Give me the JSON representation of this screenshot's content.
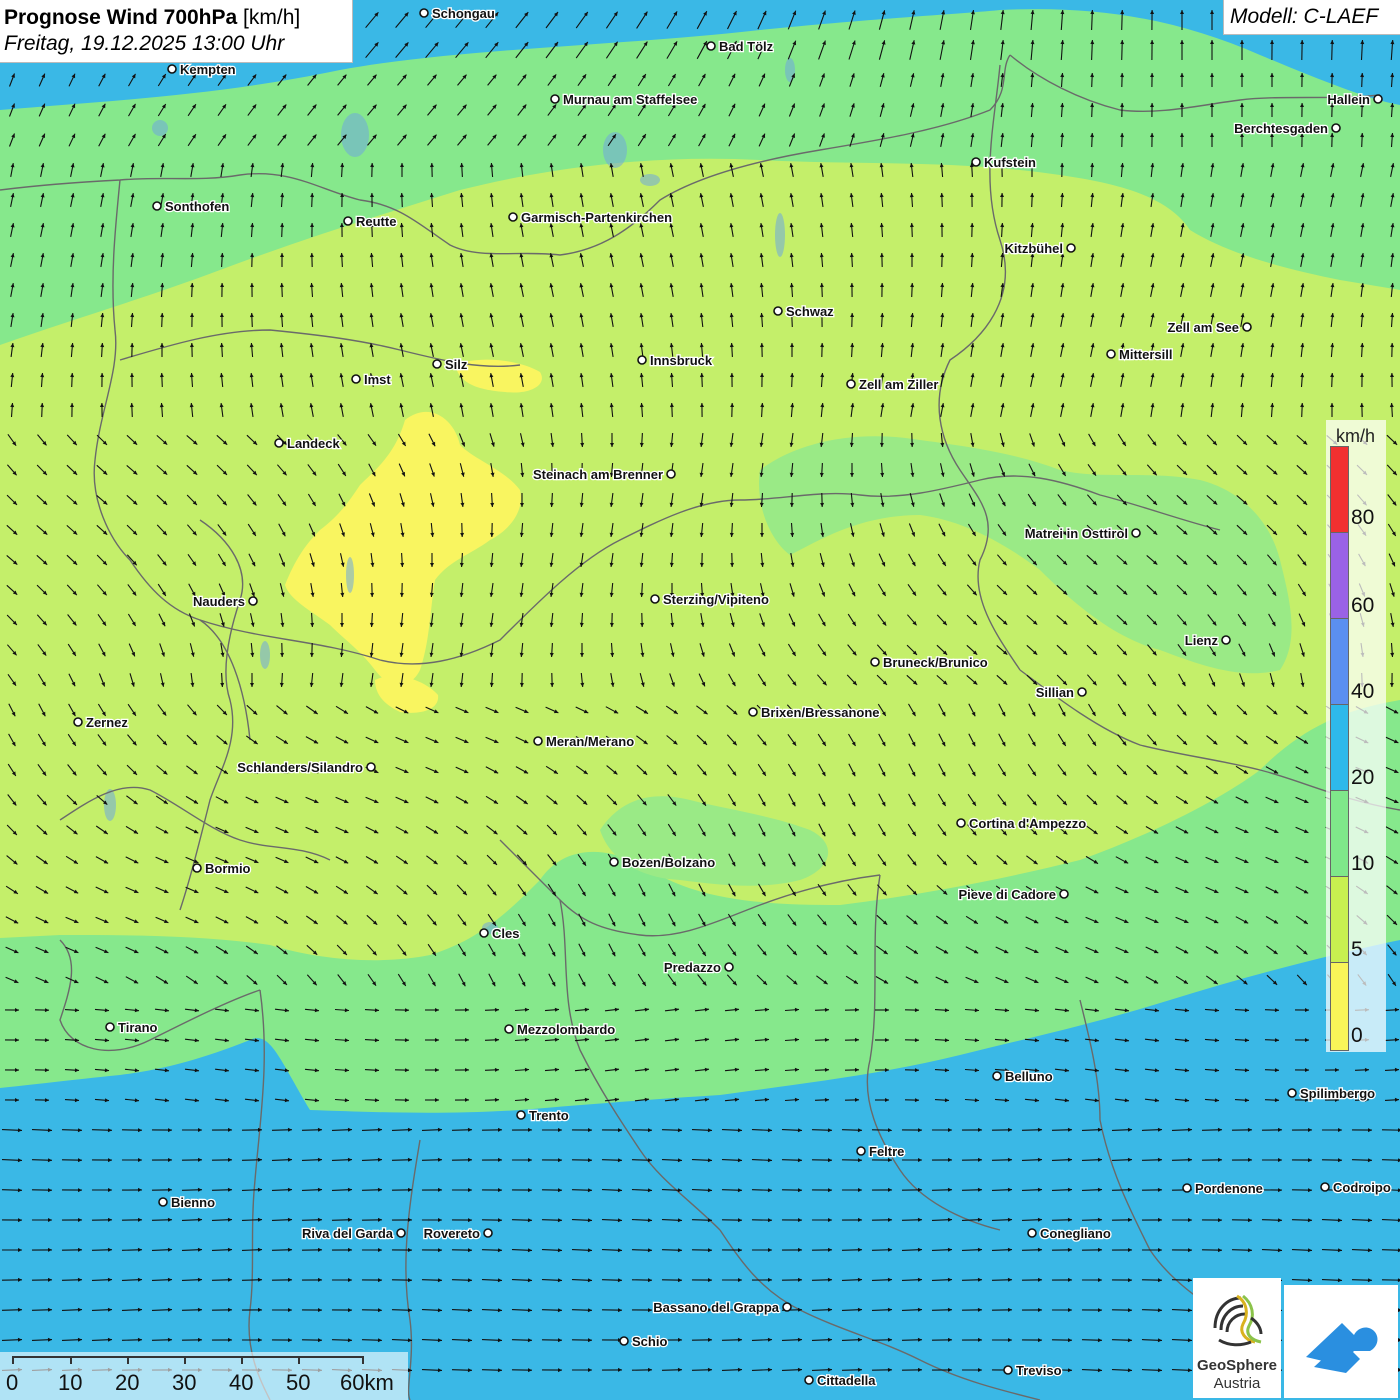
{
  "header": {
    "title": "Prognose Wind 700hPa",
    "unit": " [km/h]",
    "date": "Freitag, 19.12.2025 13:00 Uhr"
  },
  "model": {
    "label": "Modell: C-LAEF"
  },
  "legend": {
    "unit": "km/h",
    "labels": [
      "80",
      "60",
      "40",
      "20",
      "10",
      "5",
      "0"
    ],
    "colors": {
      "80": "#f23030",
      "60": "#9a62e6",
      "40": "#5b8ff0",
      "20": "#2eb9ea",
      "10": "#7fe88a",
      "5": "#c8f050",
      "0": "#f9f558"
    }
  },
  "scale": {
    "labels": [
      "0",
      "10",
      "20",
      "30",
      "40",
      "50",
      "60km"
    ]
  },
  "logos": {
    "geosphere_line1": "GeoSphere",
    "geosphere_line2": "Austria"
  },
  "palette": {
    "zone_blue": "#3ab8e6",
    "zone_green": "#86e88c",
    "zone_lime": "#c4ef6a",
    "zone_yellow": "#f9f560",
    "border_color": "#6a6a6a",
    "arrow_color": "#111111"
  },
  "cities": [
    {
      "name": "Schongau",
      "label_side": "right"
    },
    {
      "name": "Bad Tölz",
      "label_side": "right"
    },
    {
      "name": "Kempten",
      "label_side": "right"
    },
    {
      "name": "Murnau am Staffelsee",
      "label_side": "right"
    },
    {
      "name": "Hallein",
      "label_side": "left"
    },
    {
      "name": "Berchtesgaden",
      "label_side": "left"
    },
    {
      "name": "Kufstein",
      "label_side": "right"
    },
    {
      "name": "Sonthofen",
      "label_side": "right"
    },
    {
      "name": "Reutte",
      "label_side": "right"
    },
    {
      "name": "Garmisch-Partenkirchen",
      "label_side": "right"
    },
    {
      "name": "Kitzbühel",
      "label_side": "left"
    },
    {
      "name": "Schwaz",
      "label_side": "right"
    },
    {
      "name": "Zell am See",
      "label_side": "left"
    },
    {
      "name": "Silz",
      "label_side": "right"
    },
    {
      "name": "Innsbruck",
      "label_side": "right"
    },
    {
      "name": "Mittersill",
      "label_side": "right"
    },
    {
      "name": "Imst",
      "label_side": "right"
    },
    {
      "name": "Zell am Ziller",
      "label_side": "right"
    },
    {
      "name": "Landeck",
      "label_side": "right"
    },
    {
      "name": "Steinach am Brenner",
      "label_side": "left"
    },
    {
      "name": "Matrei in Osttirol",
      "label_side": "left"
    },
    {
      "name": "Nauders",
      "label_side": "left"
    },
    {
      "name": "Sterzing/Vipiteno",
      "label_side": "right"
    },
    {
      "name": "Lienz",
      "label_side": "left"
    },
    {
      "name": "Bruneck/Brunico",
      "label_side": "right"
    },
    {
      "name": "Sillian",
      "label_side": "left"
    },
    {
      "name": "Zernez",
      "label_side": "right"
    },
    {
      "name": "Brixen/Bressanone",
      "label_side": "right"
    },
    {
      "name": "Meran/Merano",
      "label_side": "right"
    },
    {
      "name": "Schlanders/Silandro",
      "label_side": "left"
    },
    {
      "name": "Cortina d'Ampezzo",
      "label_side": "right"
    },
    {
      "name": "Bormio",
      "label_side": "right"
    },
    {
      "name": "Bozen/Bolzano",
      "label_side": "right"
    },
    {
      "name": "Pieve di Cadore",
      "label_side": "left"
    },
    {
      "name": "Cles",
      "label_side": "right"
    },
    {
      "name": "Predazzo",
      "label_side": "left"
    },
    {
      "name": "Tirano",
      "label_side": "right"
    },
    {
      "name": "Mezzolombardo",
      "label_side": "right"
    },
    {
      "name": "Belluno",
      "label_side": "right"
    },
    {
      "name": "Spilimbergo",
      "label_side": "right"
    },
    {
      "name": "Trento",
      "label_side": "right"
    },
    {
      "name": "Feltre",
      "label_side": "right"
    },
    {
      "name": "Pordenone",
      "label_side": "right"
    },
    {
      "name": "Codroipo",
      "label_side": "right"
    },
    {
      "name": "Bienno",
      "label_side": "right"
    },
    {
      "name": "Riva del Garda",
      "label_side": "left"
    },
    {
      "name": "Rovereto",
      "label_side": "left"
    },
    {
      "name": "Conegliano",
      "label_side": "right"
    },
    {
      "name": "Bassano del Grappa",
      "label_side": "left"
    },
    {
      "name": "Schio",
      "label_side": "right"
    },
    {
      "name": "Treviso",
      "label_side": "right"
    },
    {
      "name": "Cittadella",
      "label_side": "right"
    }
  ]
}
